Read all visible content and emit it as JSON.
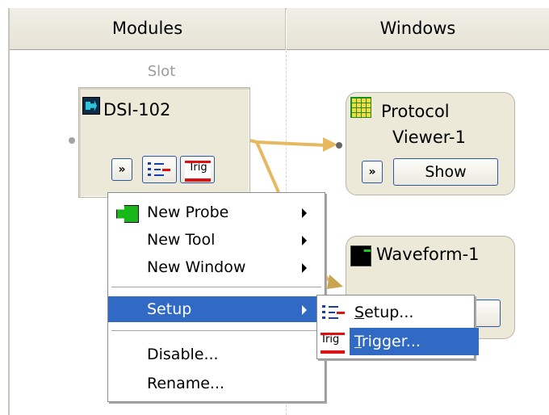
{
  "header": {
    "modules": "Modules",
    "windows": "Windows"
  },
  "slot_label": "Slot",
  "module": {
    "title": "DSI-102",
    "expand_glyph": "»",
    "setup_icon": "setup-list-icon",
    "trig_label": "Trig"
  },
  "windows": {
    "protocol_viewer": {
      "title_line1": "Protocol",
      "title_line2": "Viewer-1",
      "expand_glyph": "»",
      "show_label": "Show"
    },
    "waveform": {
      "title": "Waveform-1"
    }
  },
  "context_menu": {
    "items": [
      {
        "label": "New Probe"
      },
      {
        "label": "New Tool"
      },
      {
        "label": "New Window"
      },
      {
        "label": "Setup"
      },
      {
        "label": "Disable..."
      },
      {
        "label": "Rename..."
      }
    ]
  },
  "sub_menu": {
    "items": [
      {
        "label_mnemonic": "S",
        "label_rest": "etup...",
        "trig": ""
      },
      {
        "label_mnemonic": "T",
        "label_rest": "rigger...",
        "trig": "Trig"
      }
    ]
  },
  "colors": {
    "highlight": "#316ac5",
    "connector": "#e6b860",
    "button_border": "#2b57a4"
  }
}
